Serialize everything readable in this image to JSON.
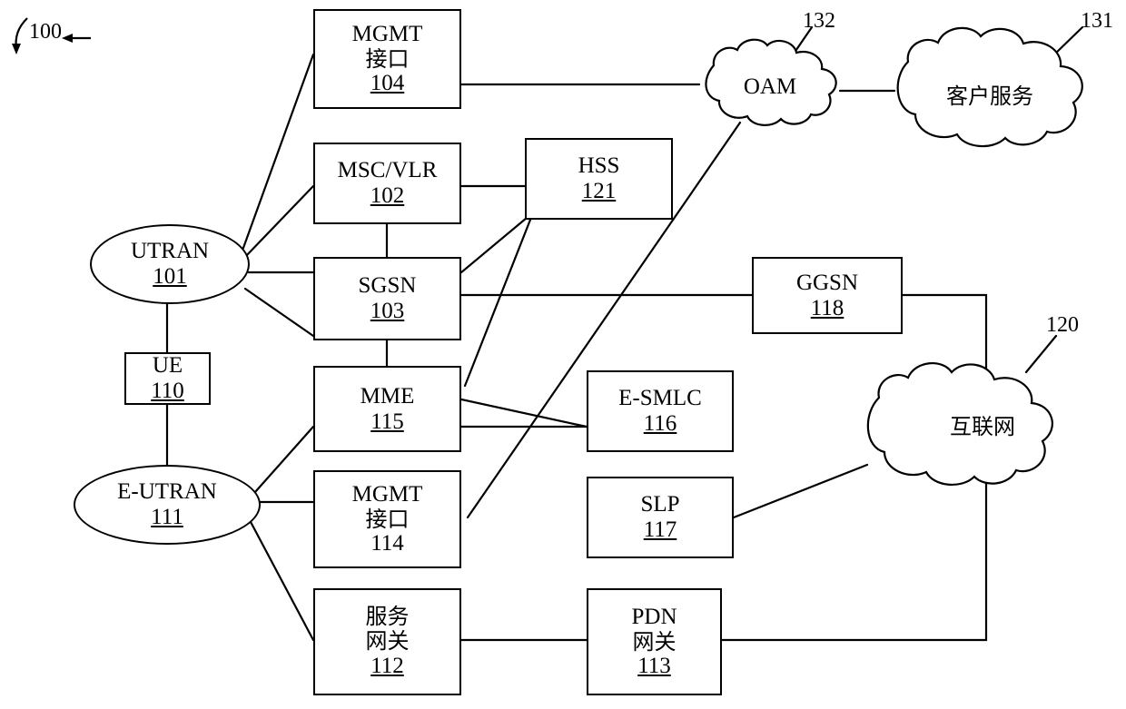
{
  "figure": {
    "ref_100": "100",
    "ref_120": "120",
    "ref_131": "131",
    "ref_132": "132"
  },
  "nodes": [
    {
      "name": "mgmt-interface-104",
      "label_line1": "MGMT",
      "label_line2": "接口",
      "number": "104"
    },
    {
      "name": "msc-vlr-102",
      "label_line1": "MSC/VLR",
      "number": "102"
    },
    {
      "name": "hss-121",
      "label_line1": "HSS",
      "number": "121"
    },
    {
      "name": "sgsn-103",
      "label_line1": "SGSN",
      "number": "103"
    },
    {
      "name": "ggsn-118",
      "label_line1": "GGSN",
      "number": "118"
    },
    {
      "name": "mme-115",
      "label_line1": "MME",
      "number": "115"
    },
    {
      "name": "e-smlc-116",
      "label_line1": "E-SMLC",
      "number": "116"
    },
    {
      "name": "mgmt-interface-114",
      "label_line1": "MGMT",
      "label_line2": "接口",
      "number": "114"
    },
    {
      "name": "slp-117",
      "label_line1": "SLP",
      "number": "117"
    },
    {
      "name": "serving-gateway-112",
      "label_line1": "服务",
      "label_line2": "网关",
      "number": "112"
    },
    {
      "name": "pdn-gateway-113",
      "label_line1": "PDN",
      "label_line2": "网关",
      "number": "113"
    },
    {
      "name": "ue-110",
      "label_line1": "UE",
      "number": "110"
    },
    {
      "name": "utran-101",
      "label_line1": "UTRAN",
      "number": "101"
    },
    {
      "name": "e-utran-111",
      "label_line1": "E-UTRAN",
      "number": "111"
    }
  ],
  "clouds": [
    {
      "name": "oam-cloud",
      "label": "OAM",
      "ref": "132"
    },
    {
      "name": "customer-service-cloud",
      "label": "客户服务",
      "ref": "131"
    },
    {
      "name": "internet-cloud",
      "label": "互联网",
      "ref": "120"
    }
  ],
  "labels": {
    "mgmt_104_line1": "MGMT",
    "mgmt_104_line2": "接口",
    "mgmt_104_num": "104",
    "msc_vlr_line1": "MSC/VLR",
    "msc_vlr_num": "102",
    "hss_line1": "HSS",
    "hss_num": "121",
    "sgsn_line1": "SGSN",
    "sgsn_num": "103",
    "ggsn_line1": "GGSN",
    "ggsn_num": "118",
    "mme_line1": "MME",
    "mme_num": "115",
    "esmlc_line1": "E-SMLC",
    "esmlc_num": "116",
    "mgmt_114_line1": "MGMT",
    "mgmt_114_line2": "接口",
    "mgmt_114_num": "114",
    "slp_line1": "SLP",
    "slp_num": "117",
    "sgw_line1": "服务",
    "sgw_line2": "网关",
    "sgw_num": "112",
    "pgw_line1": "PDN",
    "pgw_line2": "网关",
    "pgw_num": "113",
    "ue_line1": "UE",
    "ue_num": "110",
    "utran_line1": "UTRAN",
    "utran_num": "101",
    "eutran_line1": "E-UTRAN",
    "eutran_num": "111",
    "oam_label": "OAM",
    "customer_service_label": "客户服务",
    "internet_label": "互联网"
  }
}
